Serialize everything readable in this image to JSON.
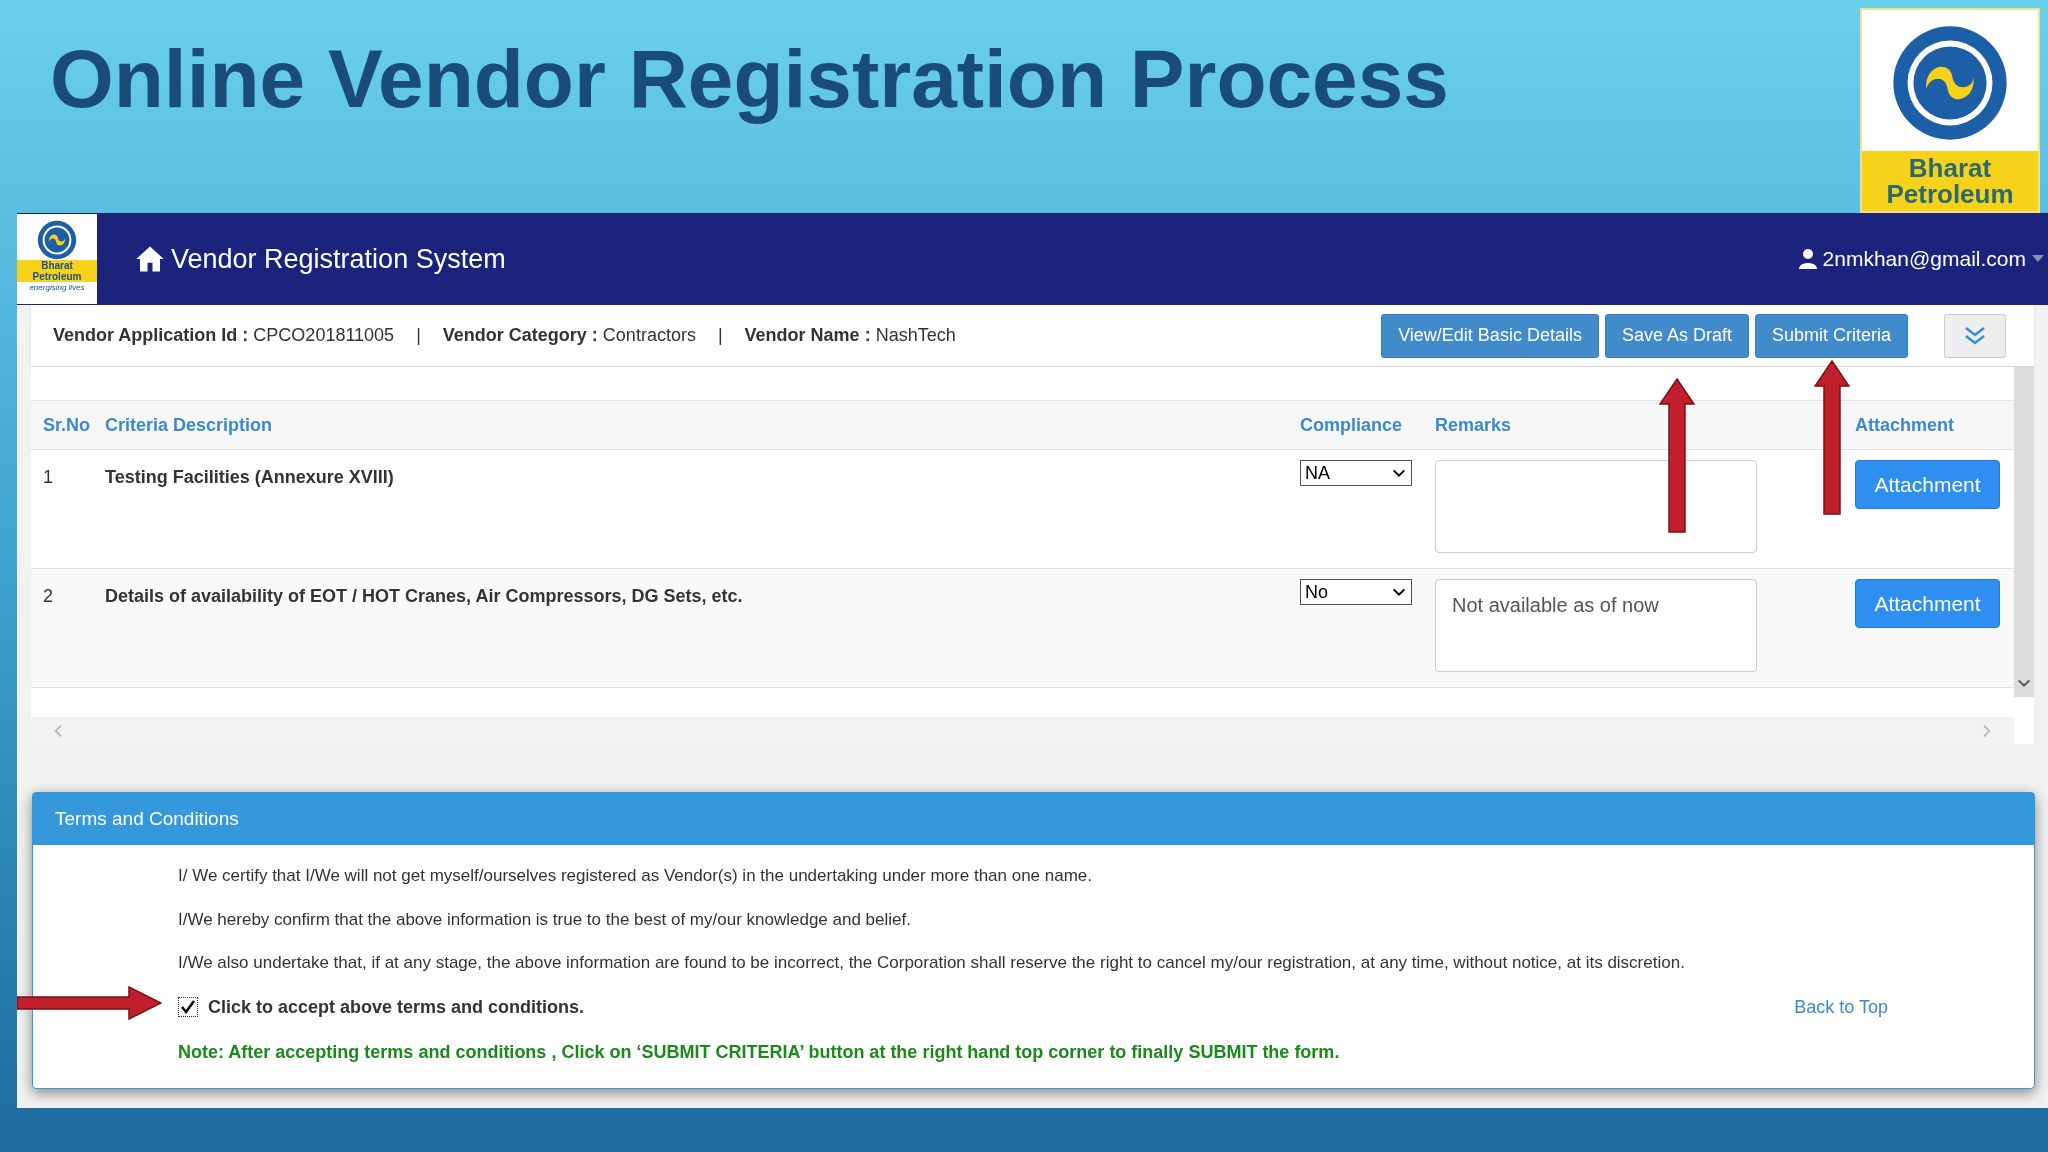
{
  "slide": {
    "title": "Online Vendor Registration Process"
  },
  "logo": {
    "line_1": "Bharat",
    "line_2": "Petroleum"
  },
  "app": {
    "small_logo": {
      "line_1": "Bharat",
      "line_2": "Petroleum",
      "tagline": "energising lives"
    },
    "title": "Vendor Registration System",
    "user": "2nmkhan@gmail.com"
  },
  "info": [
    {
      "kind": "field",
      "label": "Vendor Application Id :",
      "value": "CPCO201811005"
    },
    {
      "kind": "separator",
      "text": "|"
    },
    {
      "kind": "field",
      "label": "Vendor Category :",
      "value": "Contractors"
    },
    {
      "kind": "separator",
      "text": "|"
    },
    {
      "kind": "field",
      "label": "Vendor Name :",
      "value": "NashTech"
    }
  ],
  "buttons": [
    "View/Edit Basic Details",
    "Save As Draft",
    "Submit Criteria"
  ],
  "table": {
    "columns": [
      "Sr.No",
      "Criteria Description",
      "Compliance",
      "Remarks",
      "Attachment"
    ],
    "rows": [
      {
        "sr": "1",
        "description": "Testing Facilities (Annexure XVIII)",
        "compliance": "NA",
        "attachment": "Attachment"
      },
      {
        "sr": "2",
        "description": "Details of availability of EOT / HOT Cranes, Air Compressors, DG Sets, etc.",
        "compliance": "No",
        "remarks": "Not available as of now",
        "attachment": "Attachment"
      }
    ]
  },
  "terms": {
    "title": "Terms and Conditions",
    "paragraphs": [
      "I/ We certify that I/We will not get myself/ourselves registered as Vendor(s) in the undertaking under more than one name.",
      "I/We hereby confirm that the above information is true to the best of my/our knowledge and belief.",
      "I/We also undertake that, if at any stage, the above information are found to be incorrect, the Corporation shall reserve the right to cancel my/our registration, at any time, without notice, at its discretion."
    ],
    "accept": {
      "label": "Click to accept above terms and conditions.",
      "checked": true
    },
    "back_to_top": "Back to Top",
    "note": "Note: After accepting terms and conditions , Click on ‘SUBMIT CRITERIA’ button at the right hand top corner to finally SUBMIT the form."
  }
}
